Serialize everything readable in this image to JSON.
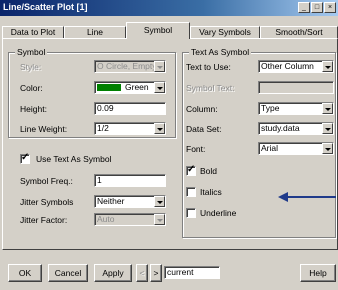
{
  "window": {
    "title": "Line/Scatter Plot [1]",
    "controls": [
      "_",
      "□",
      "×"
    ]
  },
  "tabs": [
    {
      "label": "Data to Plot",
      "active": false
    },
    {
      "label": "Line",
      "active": false
    },
    {
      "label": "Symbol",
      "active": true
    },
    {
      "label": "Vary Symbols",
      "active": false
    },
    {
      "label": "Smooth/Sort",
      "active": false
    }
  ],
  "symbol_group": {
    "title": "Symbol",
    "style_label": "Style:",
    "style_value": "O Circle, Empty",
    "color_label": "Color:",
    "color_value": "Green",
    "color_swatch": "#008000",
    "height_label": "Height:",
    "height_value": "0.09",
    "line_weight_label": "Line Weight:",
    "line_weight_value": "1/2"
  },
  "use_text_as_symbol": {
    "label": "Use Text As Symbol",
    "checked": true
  },
  "symbol_freq": {
    "label": "Symbol Freq.:",
    "value": "1"
  },
  "jitter_symbols": {
    "label": "Jitter Symbols",
    "value": "Neither"
  },
  "jitter_factor": {
    "label": "Jitter Factor:",
    "value": "Auto"
  },
  "text_group": {
    "title": "Text As Symbol",
    "text_to_use_label": "Text to Use:",
    "text_to_use_value": "Other Column",
    "symbol_text_label": "Symbol Text:",
    "symbol_text_value": "",
    "column_label": "Column:",
    "column_value": "Type",
    "data_set_label": "Data Set:",
    "data_set_value": "study.data",
    "font_label": "Font:",
    "font_value": "Arial",
    "bold": {
      "label": "Bold",
      "checked": true
    },
    "italics": {
      "label": "Italics",
      "checked": false
    },
    "underline": {
      "label": "Underline",
      "checked": false
    }
  },
  "footer": {
    "ok": "OK",
    "cancel": "Cancel",
    "apply": "Apply",
    "prev": "<",
    "next": ">",
    "current": "current",
    "help": "Help"
  },
  "annotation_arrow_color": "#1f3a8a"
}
